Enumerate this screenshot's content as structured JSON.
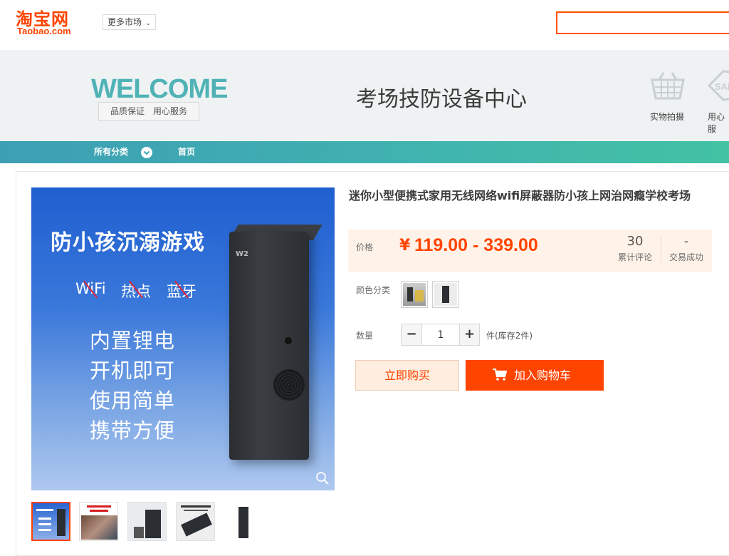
{
  "header": {
    "logo_cn": "淘宝网",
    "logo_en": "Taobao.com",
    "more_markets": "更多市场",
    "search_placeholder": ""
  },
  "banner": {
    "welcome": "WELCOME",
    "welcome_sub": "品质保证　用心服务",
    "shop_title": "考场技防设备中心",
    "icons": [
      {
        "label": "实物拍摄",
        "icon": "basket-icon"
      },
      {
        "label": "用心服",
        "icon": "sale-tag-icon"
      }
    ]
  },
  "nav": {
    "all_categories": "所有分类",
    "home": "首页"
  },
  "product": {
    "title": "迷你小型便携式家用无线网络wifi屏蔽器防小孩上网治网瘾学校考场",
    "price_label": "价格",
    "price_currency": "¥",
    "price_range": "119.00 - 339.00",
    "reviews_count": "30",
    "reviews_label": "累计评论",
    "deals_count": "-",
    "deals_label": "交易成功",
    "color_label": "颜色分类",
    "quantity_label": "数量",
    "quantity_value": "1",
    "stock_text": "件(库存2件)",
    "buy_now": "立即购买",
    "add_to_cart": "加入购物车"
  },
  "main_image": {
    "headline": "防小孩沉溺游戏",
    "struck_words": [
      "WiFi",
      "热点",
      "蓝牙"
    ],
    "features": [
      "内置锂电",
      "开机即可",
      "使用简单",
      "携带方便"
    ],
    "device_logo": "W2"
  },
  "colors": {
    "brand": "#ff4400",
    "nav_start": "#3d9fb4",
    "nav_end": "#43c2a4",
    "price_bg": "#fff2e8",
    "welcome": "#4fb3b6"
  }
}
